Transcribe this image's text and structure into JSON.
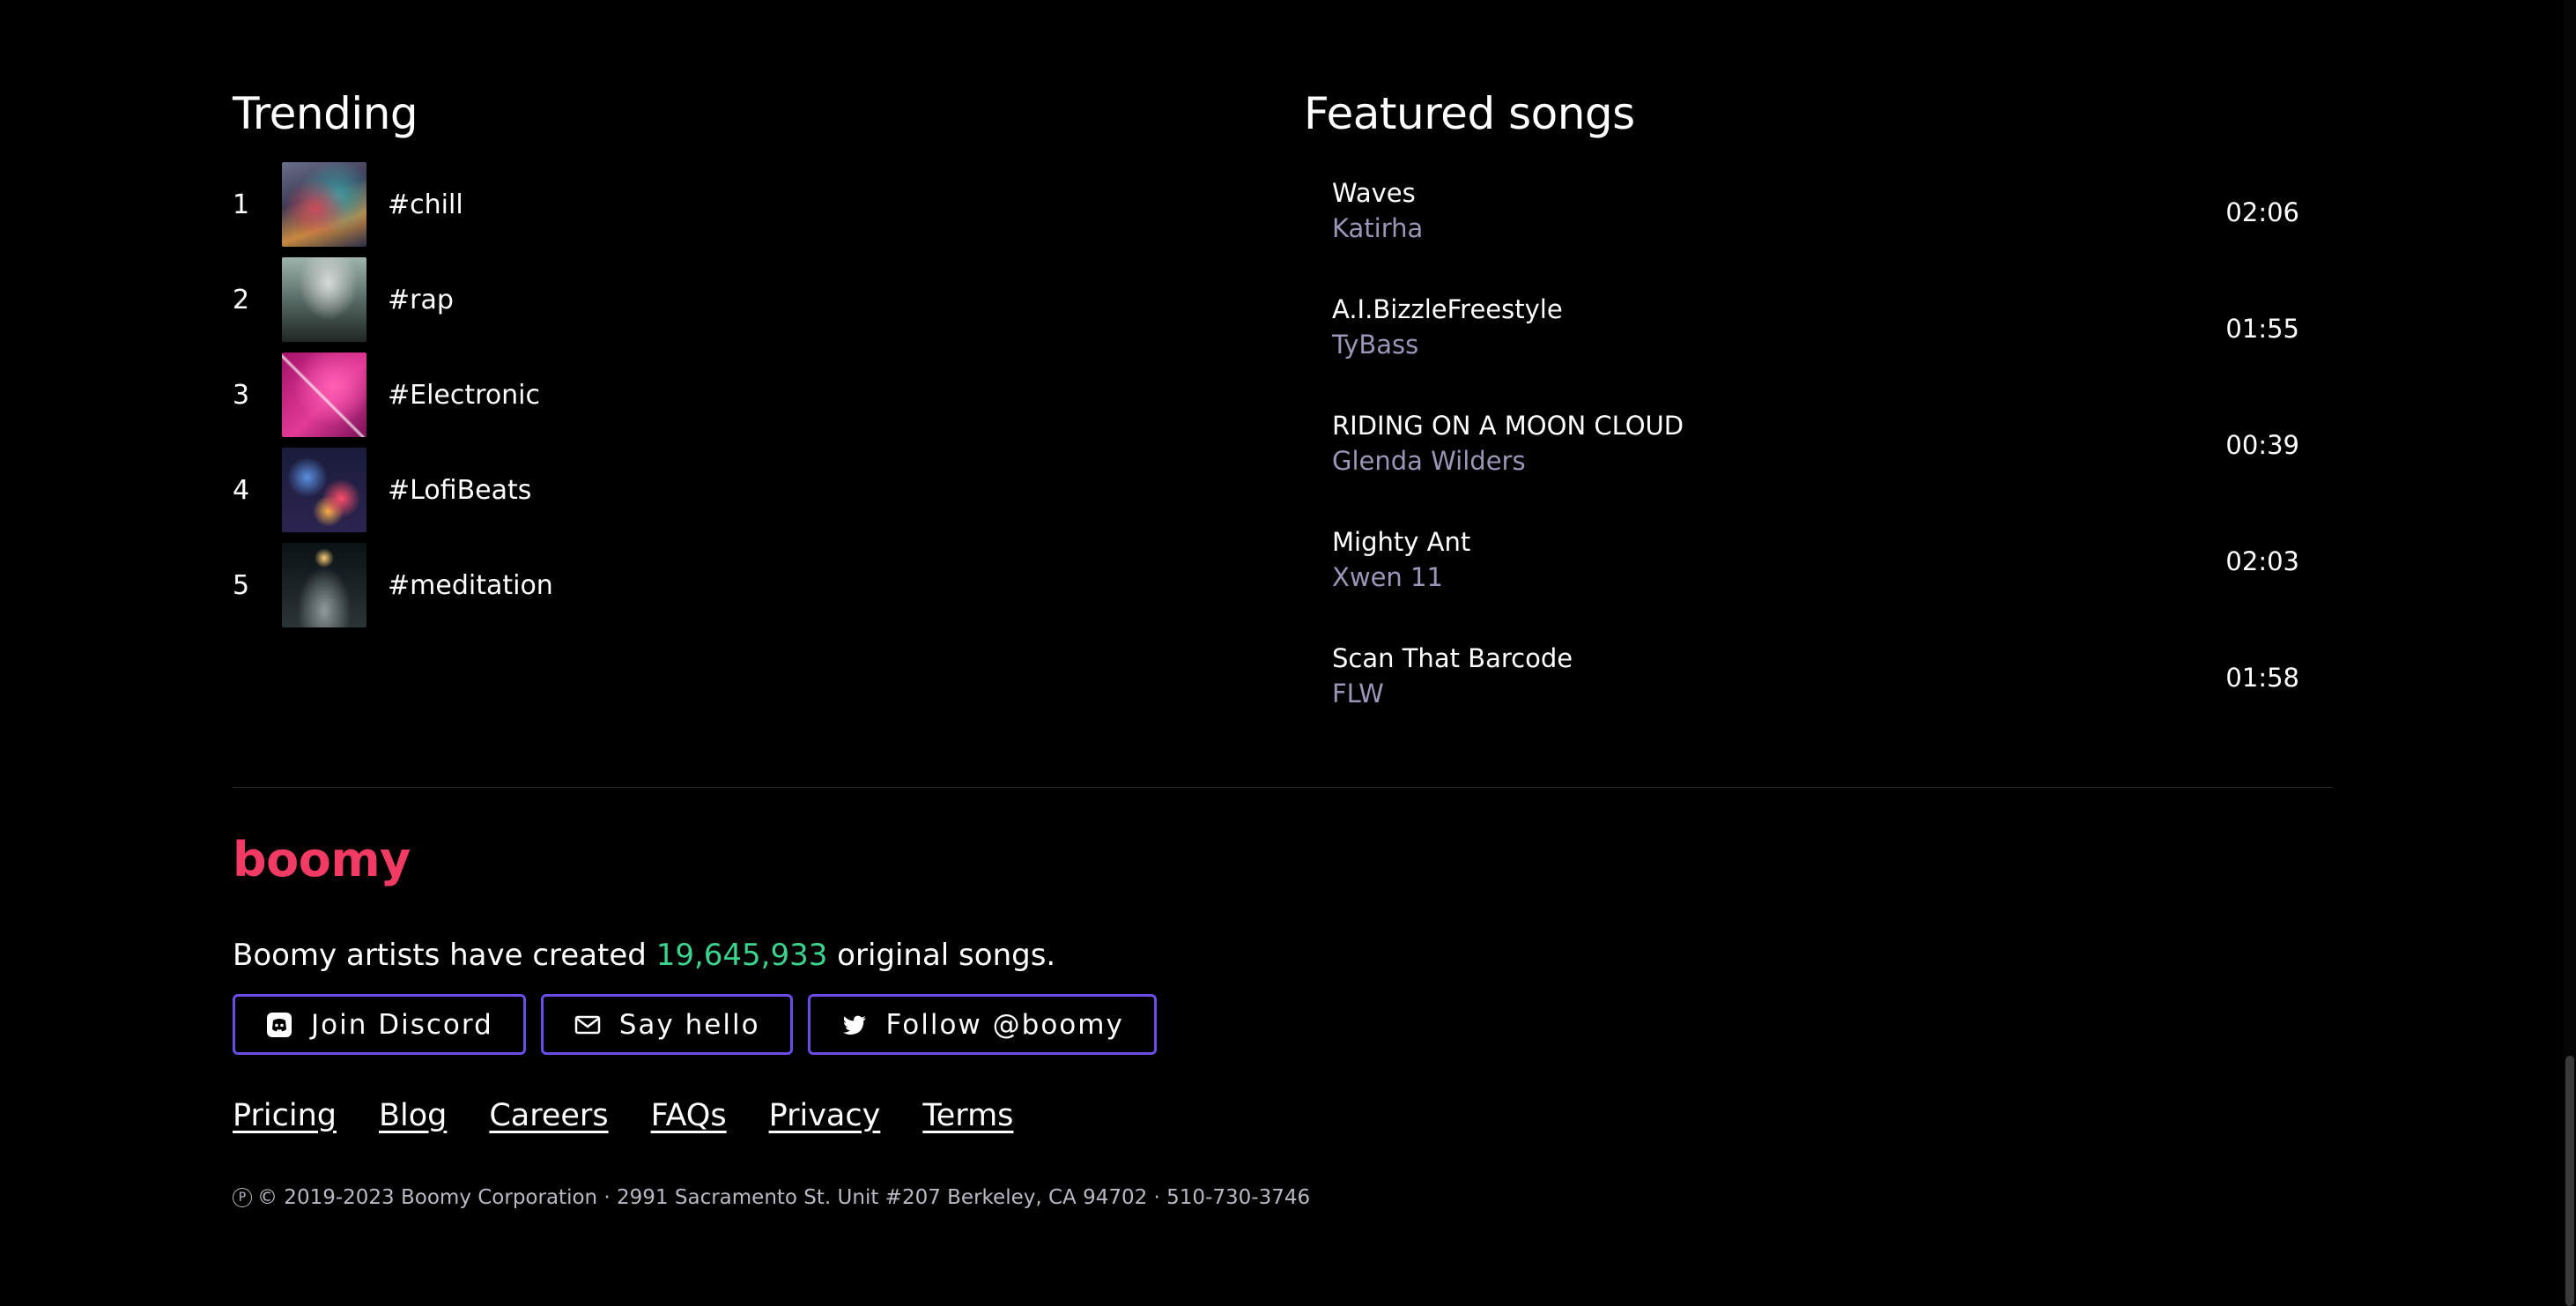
{
  "trending": {
    "title": "Trending",
    "items": [
      {
        "rank": "1",
        "tag": "#chill"
      },
      {
        "rank": "2",
        "tag": "#rap"
      },
      {
        "rank": "3",
        "tag": "#Electronic"
      },
      {
        "rank": "4",
        "tag": "#LofiBeats"
      },
      {
        "rank": "5",
        "tag": "#meditation"
      }
    ]
  },
  "featured": {
    "title": "Featured songs",
    "songs": [
      {
        "title": "Waves",
        "artist": "Katirha",
        "duration": "02:06"
      },
      {
        "title": "A.I.BizzleFreestyle",
        "artist": "TyBass",
        "duration": "01:55"
      },
      {
        "title": "RIDING ON A MOON CLOUD",
        "artist": "Glenda Wilders",
        "duration": "00:39"
      },
      {
        "title": "Mighty Ant",
        "artist": "Xwen 11",
        "duration": "02:03"
      },
      {
        "title": "Scan That Barcode",
        "artist": "FLW",
        "duration": "01:58"
      }
    ]
  },
  "footer": {
    "brand": "boomy",
    "stats_prefix": "Boomy artists have created ",
    "song_count": "19,645,933",
    "stats_suffix": " original songs.",
    "buttons": {
      "discord": "Join Discord",
      "hello": "Say hello",
      "twitter": "Follow @boomy"
    },
    "links": [
      "Pricing",
      "Blog",
      "Careers",
      "FAQs",
      "Privacy",
      "Terms"
    ],
    "copyright": "© 2019-2023 Boomy Corporation · 2991 Sacramento St. Unit #207 Berkeley, CA 94702 · 510-730-3746",
    "p_symbol": "P"
  },
  "colors": {
    "brand": "#f13a64",
    "count": "#3bd38e",
    "button_border": "#6b4de6",
    "artist_text": "#9b95b8"
  },
  "icons": {
    "discord": "discord-icon",
    "hello": "mail-icon",
    "twitter": "twitter-icon"
  }
}
